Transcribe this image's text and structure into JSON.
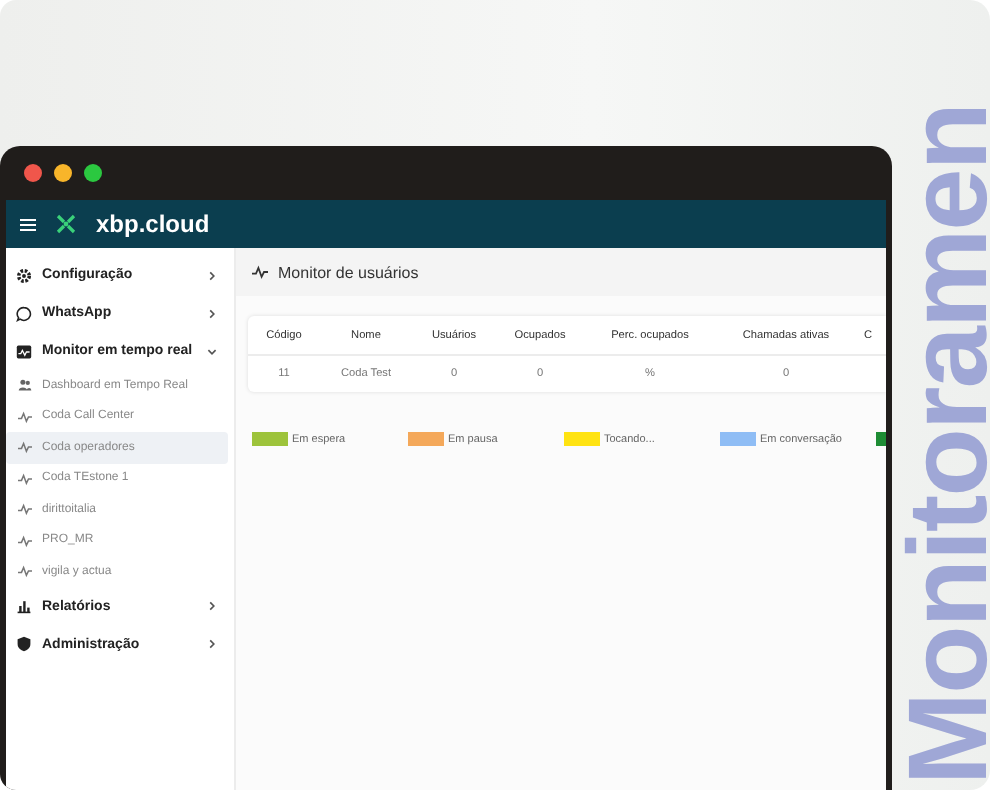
{
  "banner_text": "Monitoramen",
  "app": {
    "logo": "xbp.cloud"
  },
  "sidebar": {
    "items": [
      {
        "label": "Configuração",
        "expanded": false
      },
      {
        "label": "WhatsApp",
        "expanded": false
      },
      {
        "label": "Monitor em tempo real",
        "expanded": true,
        "children": [
          {
            "label": "Dashboard em Tempo Real",
            "selected": false
          },
          {
            "label": "Coda Call Center",
            "selected": false
          },
          {
            "label": "Coda operadores",
            "selected": true
          },
          {
            "label": "Coda TEstone 1",
            "selected": false
          },
          {
            "label": "dirittoitalia",
            "selected": false
          },
          {
            "label": "PRO_MR",
            "selected": false
          },
          {
            "label": "vigila y actua",
            "selected": false
          }
        ]
      },
      {
        "label": "Relatórios",
        "expanded": false
      },
      {
        "label": "Administração",
        "expanded": false
      }
    ]
  },
  "page": {
    "title": "Monitor de usuários"
  },
  "table": {
    "columns": [
      "Código",
      "Nome",
      "Usuários",
      "Ocupados",
      "Perc. ocupados",
      "Chamadas ativas",
      "C"
    ],
    "rows": [
      [
        "11",
        "Coda Test",
        "0",
        "0",
        "%",
        "0",
        ""
      ]
    ]
  },
  "legend": [
    {
      "label": "Em espera",
      "color": "#9dc33b"
    },
    {
      "label": "Em pausa",
      "color": "#f4a85a"
    },
    {
      "label": "Tocando...",
      "color": "#ffe312"
    },
    {
      "label": "Em conversação",
      "color": "#8fbdf5"
    },
    {
      "color": "#1e8c34"
    }
  ]
}
